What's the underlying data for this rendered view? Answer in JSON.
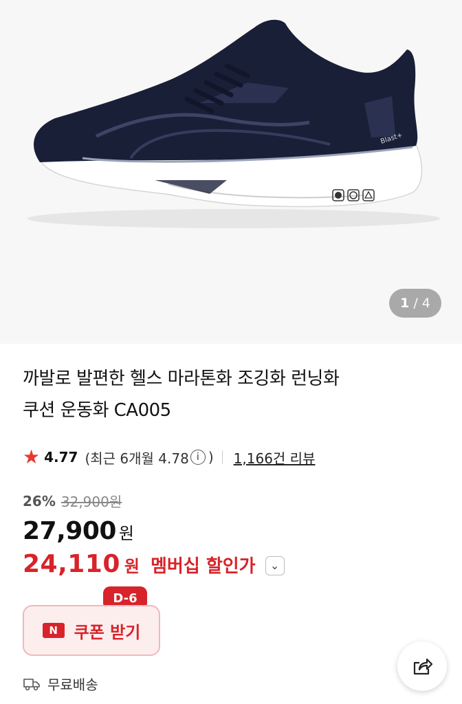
{
  "gallery": {
    "current": "1",
    "separator": "/",
    "total": "4"
  },
  "shoe": {
    "brand_mark": "Blast+"
  },
  "product": {
    "title_line1": "까발로 발편한 헬스 마라톤화 조깅화 런닝화",
    "title_line2": "쿠션 운동화 CA005"
  },
  "rating": {
    "score": "4.77",
    "recent_prefix": "(최근 6개월 4.78",
    "info_icon": "i",
    "recent_suffix": ")",
    "reviews": "1,166건 리뷰"
  },
  "pricing": {
    "discount_pct": "26%",
    "original_price": "32,900원",
    "sale_price": "27,900",
    "unit": "원",
    "member_price": "24,110",
    "member_label": "멤버십 할인가",
    "member_chevron": "⌄"
  },
  "coupon": {
    "badge": "D-6",
    "icon_letter": "N",
    "label": "쿠폰 받기"
  },
  "shipping": {
    "label": "무료배송"
  },
  "colors": {
    "accent_red": "#d8232a",
    "shoe_navy": "#1a1f38"
  }
}
